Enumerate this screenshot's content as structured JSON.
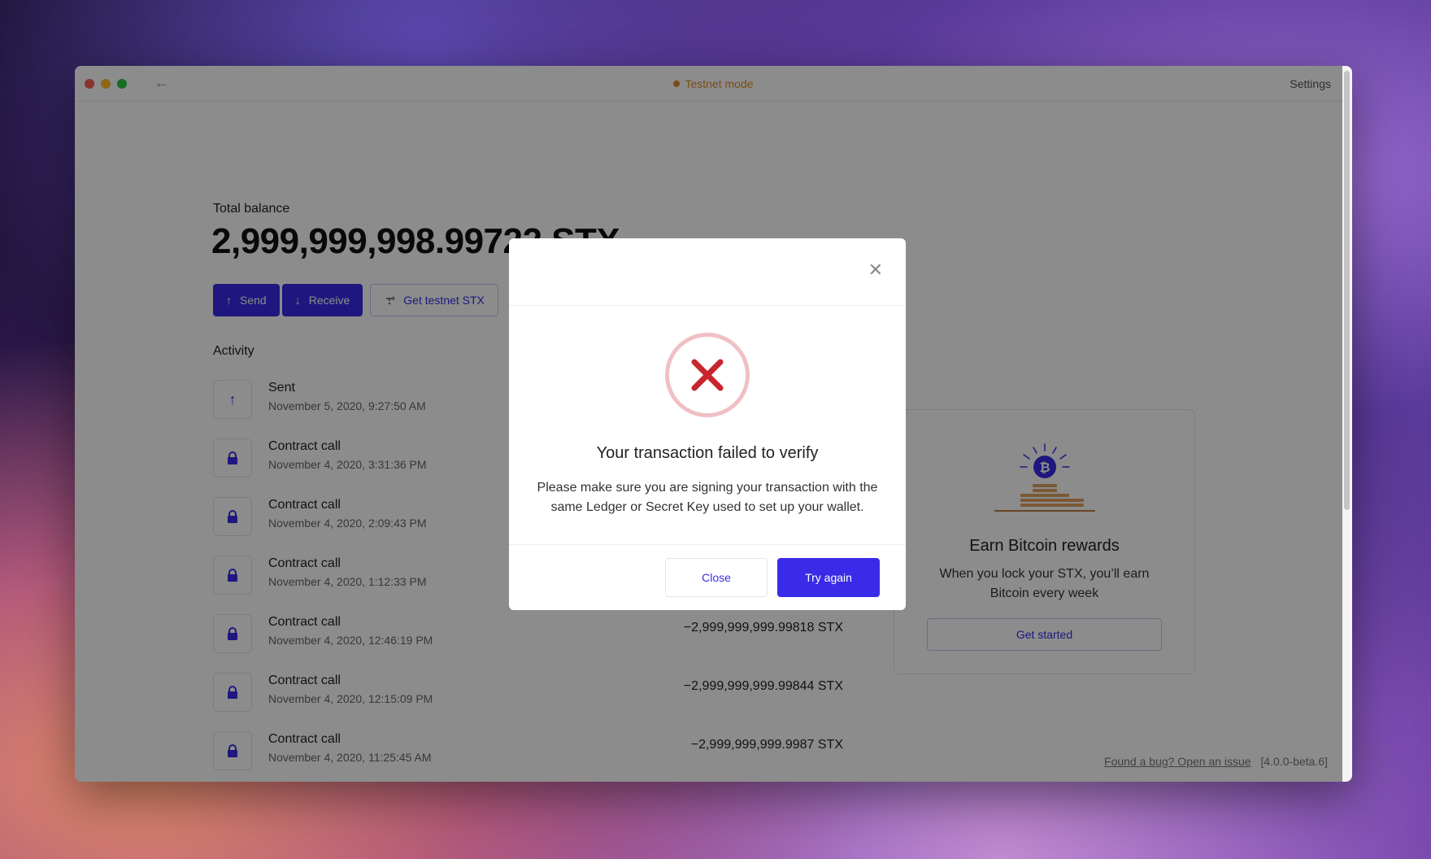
{
  "titlebar": {
    "back_icon": "arrow-left-icon",
    "mode_label": "Testnet mode",
    "mode_color": "#e08a2a",
    "settings_label": "Settings"
  },
  "balance": {
    "label": "Total balance",
    "value": "2,999,999,998.99722 STX"
  },
  "actions": {
    "send_label": "Send",
    "receive_label": "Receive",
    "faucet_label": "Get testnet STX"
  },
  "activity": {
    "title": "Activity",
    "items": [
      {
        "title": "Sent",
        "date": "November 5, 2020, 9:27:50 AM",
        "amount": "",
        "icon": "arrow-up-icon"
      },
      {
        "title": "Contract call",
        "date": "November 4, 2020, 3:31:36 PM",
        "amount": "",
        "icon": "lock-icon"
      },
      {
        "title": "Contract call",
        "date": "November 4, 2020, 2:09:43 PM",
        "amount": "",
        "icon": "lock-icon"
      },
      {
        "title": "Contract call",
        "date": "November 4, 2020, 1:12:33 PM",
        "amount": "",
        "icon": "lock-icon"
      },
      {
        "title": "Contract call",
        "date": "November 4, 2020, 12:46:19 PM",
        "amount": "−2,999,999,999.99818 STX",
        "icon": "lock-icon"
      },
      {
        "title": "Contract call",
        "date": "November 4, 2020, 12:15:09 PM",
        "amount": "−2,999,999,999.99844 STX",
        "icon": "lock-icon"
      },
      {
        "title": "Contract call",
        "date": "November 4, 2020, 11:25:45 AM",
        "amount": "−2,999,999,999.9987 STX",
        "icon": "lock-icon"
      }
    ]
  },
  "earn": {
    "title": "Earn Bitcoin rewards",
    "description": "When you lock your STX, you’ll earn Bitcoin every week",
    "button_label": "Get started"
  },
  "footer": {
    "bug_link": "Found a bug? Open an issue",
    "version": "[4.0.0-beta.6]"
  },
  "modal": {
    "close_icon": "close-icon",
    "status_icon": "error-x-icon",
    "title": "Your transaction failed to verify",
    "description": "Please make sure you are signing your transaction with the same Ledger or Secret Key used to set up your wallet.",
    "close_label": "Close",
    "retry_label": "Try again"
  },
  "colors": {
    "accent": "#3a2be8",
    "error": "#c8262e",
    "error_ring": "#f0c0c4"
  }
}
